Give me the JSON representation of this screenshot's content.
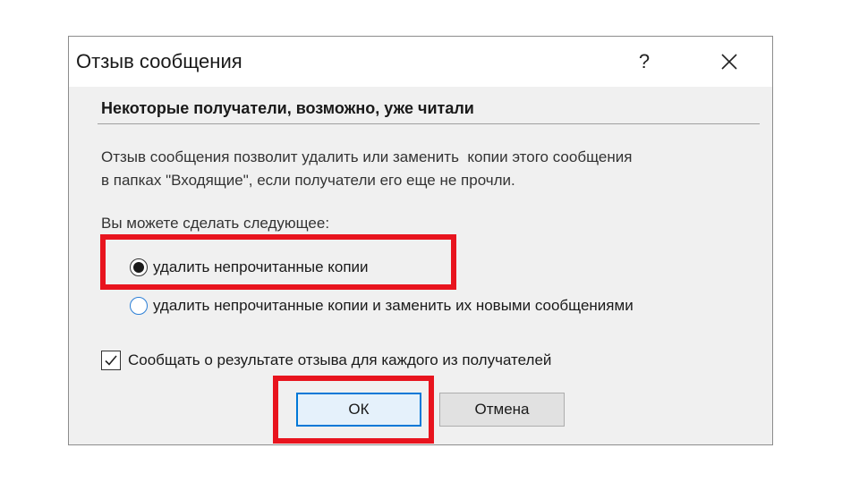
{
  "dialog": {
    "title": "Отзыв сообщения",
    "help_label": "?",
    "close_icon": "close-icon"
  },
  "content": {
    "heading": "Некоторые получатели, возможно, уже читали",
    "description": "Отзыв сообщения позволит удалить или заменить  копии этого сообщения\nв папках \"Входящие\", если получатели его еще не прочли.",
    "options_label": "Вы можете сделать следующее:",
    "options": [
      {
        "label": "удалить непрочитанные копии",
        "selected": true
      },
      {
        "label": "удалить непрочитанные копии и заменить их новыми сообщениями",
        "selected": false
      }
    ],
    "report_checkbox": {
      "label": "Сообщать о результате отзыва для каждого из получателей",
      "checked": true
    }
  },
  "buttons": {
    "ok_label": "ОК",
    "cancel_label": "Отмена"
  },
  "colors": {
    "highlight": "#e8141e",
    "focus_accent": "#0078d7"
  }
}
